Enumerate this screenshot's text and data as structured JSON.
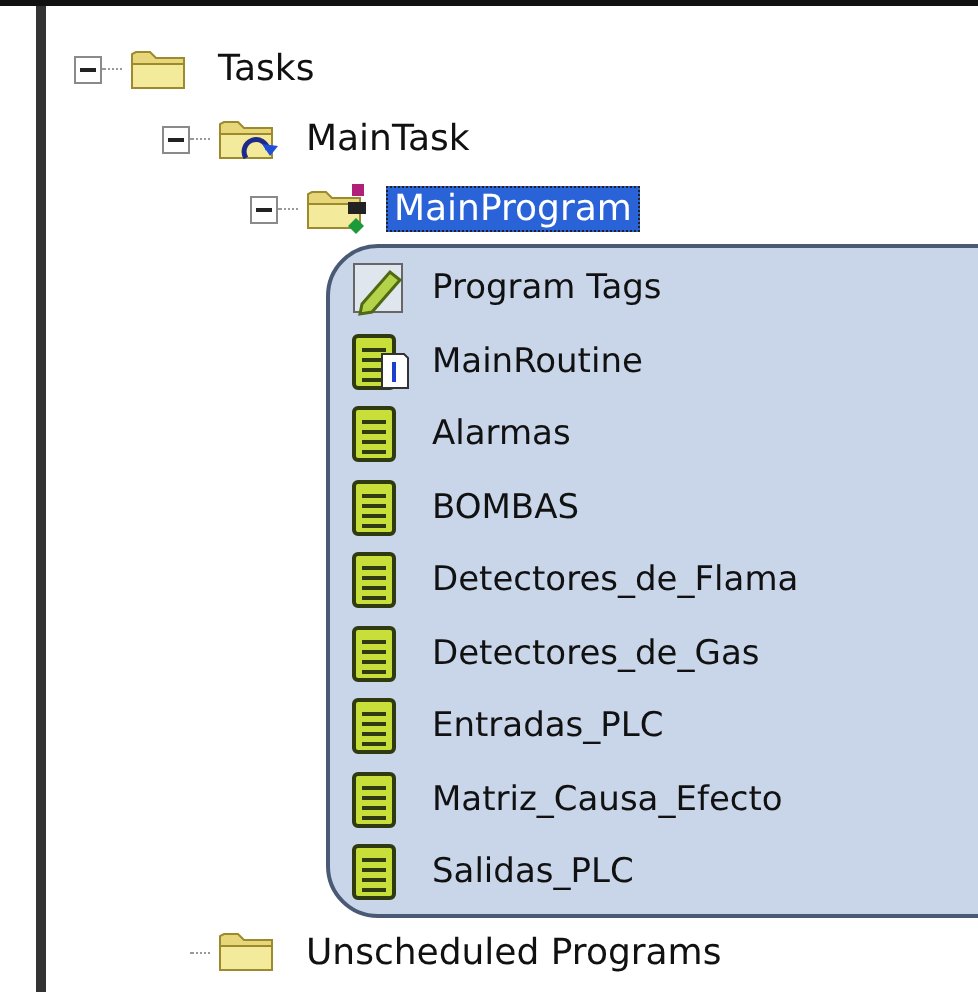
{
  "tree": [
    {
      "label": "Tasks",
      "kind": "folder",
      "expanded": true,
      "selected": false,
      "children": [
        {
          "label": "MainTask",
          "kind": "task",
          "expanded": true,
          "selected": false,
          "children": [
            {
              "label": "MainProgram",
              "kind": "program",
              "expanded": true,
              "selected": true,
              "highlighted": true,
              "children": [
                {
                  "label": "Program Tags",
                  "kind": "tags",
                  "selected": false
                },
                {
                  "label": "MainRoutine",
                  "kind": "main-routine",
                  "selected": false
                },
                {
                  "label": "Alarmas",
                  "kind": "routine",
                  "selected": false
                },
                {
                  "label": "BOMBAS",
                  "kind": "routine",
                  "selected": false
                },
                {
                  "label": "Detectores_de_Flama",
                  "kind": "routine",
                  "selected": false
                },
                {
                  "label": "Detectores_de_Gas",
                  "kind": "routine",
                  "selected": false
                },
                {
                  "label": "Entradas_PLC",
                  "kind": "routine",
                  "selected": false
                },
                {
                  "label": "Matriz_Causa_Efecto",
                  "kind": "routine",
                  "selected": false
                },
                {
                  "label": "Salidas_PLC",
                  "kind": "routine",
                  "selected": false
                }
              ]
            }
          ]
        },
        {
          "label": "Unscheduled Programs",
          "kind": "folder",
          "selected": false
        }
      ]
    }
  ]
}
